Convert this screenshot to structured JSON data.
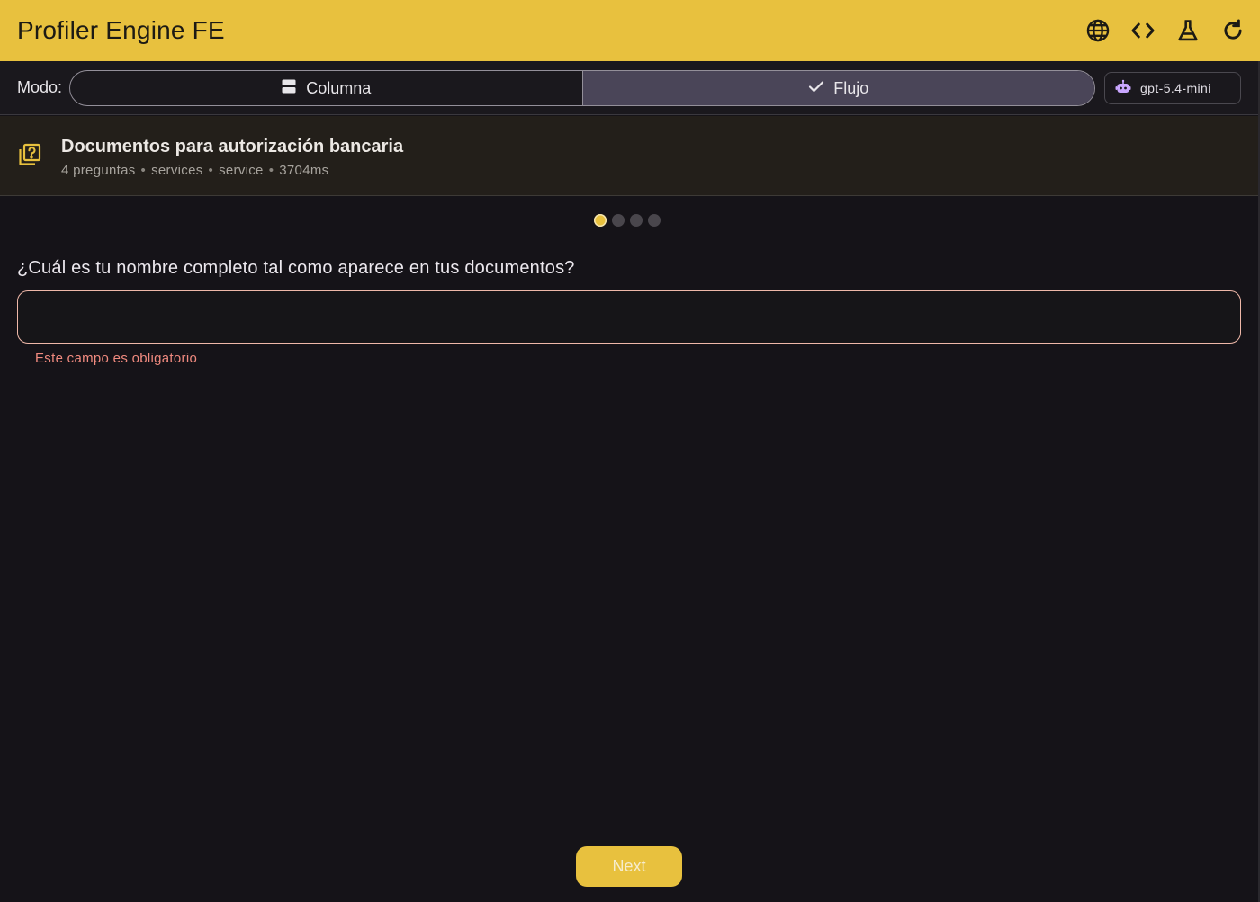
{
  "app": {
    "title": "Profiler Engine FE",
    "actions": [
      {
        "name": "language",
        "icon": "globe-icon"
      },
      {
        "name": "code",
        "icon": "code-icon"
      },
      {
        "name": "lab",
        "icon": "flask-icon"
      },
      {
        "name": "refresh",
        "icon": "refresh-icon"
      }
    ]
  },
  "mode": {
    "label": "Modo:",
    "options": [
      {
        "label": "Columna",
        "icon": "view-agenda-icon",
        "selected": false
      },
      {
        "label": "Flujo",
        "icon": "check-icon",
        "selected": true
      }
    ],
    "model": {
      "label": "gpt-5.4-mini",
      "icon": "robot-icon"
    }
  },
  "form_header": {
    "title": "Documentos para autorización bancaria",
    "meta": [
      "4 preguntas",
      "services",
      "service",
      "3704ms"
    ],
    "icon": "quiz-icon"
  },
  "steps": {
    "total": 4,
    "current": 1
  },
  "question": {
    "text": "¿Cuál es tu nombre completo tal como aparece en tus documentos?",
    "value": "",
    "placeholder": "",
    "error": "Este campo es obligatorio"
  },
  "footer": {
    "next_label": "Next"
  },
  "colors": {
    "accent": "#e8c13e",
    "background": "#151318",
    "error": "#f08a7f",
    "segment_selected": "#4a4558"
  }
}
